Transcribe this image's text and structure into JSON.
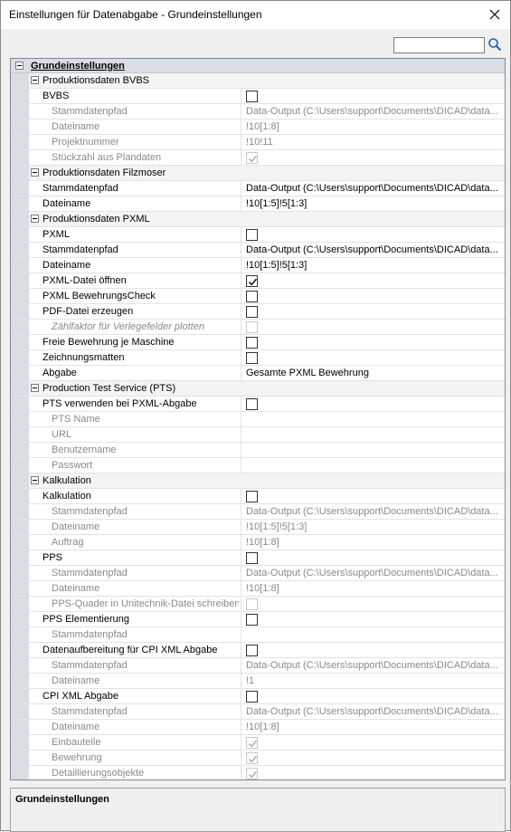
{
  "window": {
    "title": "Einstellungen für Datenabgabe - Grundeinstellungen"
  },
  "search": {
    "value": "",
    "placeholder": ""
  },
  "rows": [
    {
      "type": "top",
      "label": "Grundeinstellungen"
    },
    {
      "type": "cat",
      "label": "Produktionsdaten BVBS"
    },
    {
      "label": "BVBS",
      "checkbox": "unchecked"
    },
    {
      "label": "Stammdatenpfad",
      "sub": true,
      "disabled": true,
      "value": "Data-Output   (C:\\Users\\support\\Documents\\DICAD\\data..."
    },
    {
      "label": "Dateiname",
      "sub": true,
      "disabled": true,
      "value": "!10[1:8]"
    },
    {
      "label": "Projektnummer",
      "sub": true,
      "disabled": true,
      "value": "!10!11"
    },
    {
      "label": "Stückzahl aus Plandaten",
      "sub": true,
      "disabled": true,
      "checkbox": "checked"
    },
    {
      "type": "cat",
      "label": "Produktionsdaten Filzmoser"
    },
    {
      "label": "Stammdatenpfad",
      "value": "Data-Output   (C:\\Users\\support\\Documents\\DICAD\\data..."
    },
    {
      "label": "Dateiname",
      "value": "!10[1:5]!5[1:3]"
    },
    {
      "type": "cat",
      "label": "Produktionsdaten PXML"
    },
    {
      "label": "PXML",
      "checkbox": "unchecked"
    },
    {
      "label": "Stammdatenpfad",
      "value": "Data-Output   (C:\\Users\\support\\Documents\\DICAD\\data..."
    },
    {
      "label": "Dateiname",
      "value": "!10[1:5]!5[1:3]"
    },
    {
      "label": "PXML-Datei öffnen",
      "checkbox": "checked"
    },
    {
      "label": "PXML BewehrungsCheck",
      "checkbox": "unchecked"
    },
    {
      "label": "PDF-Datei erzeugen",
      "checkbox": "unchecked"
    },
    {
      "label": "Zählfaktor für Verlegefelder plotten",
      "sub": true,
      "disabled": true,
      "italic": true,
      "checkbox": "unchecked"
    },
    {
      "label": "Freie Bewehrung je Maschine",
      "checkbox": "unchecked"
    },
    {
      "label": "Zeichnungsmatten",
      "checkbox": "unchecked"
    },
    {
      "label": "Abgabe",
      "value": "Gesamte PXML Bewehrung"
    },
    {
      "type": "cat",
      "label": "Production Test Service (PTS)"
    },
    {
      "label": "PTS verwenden bei PXML-Abgabe",
      "checkbox": "unchecked"
    },
    {
      "label": "PTS Name",
      "sub": true,
      "disabled": true,
      "value": ""
    },
    {
      "label": "URL",
      "sub": true,
      "disabled": true,
      "value": ""
    },
    {
      "label": "Benutzername",
      "sub": true,
      "disabled": true,
      "value": ""
    },
    {
      "label": "Passwort",
      "sub": true,
      "disabled": true,
      "value": ""
    },
    {
      "type": "cat",
      "label": "Kalkulation"
    },
    {
      "label": "Kalkulation",
      "checkbox": "unchecked"
    },
    {
      "label": "Stammdatenpfad",
      "sub": true,
      "disabled": true,
      "value": "Data-Output   (C:\\Users\\support\\Documents\\DICAD\\data..."
    },
    {
      "label": "Dateiname",
      "sub": true,
      "disabled": true,
      "value": "!10[1:5]!5[1:3]"
    },
    {
      "label": "Auftrag",
      "sub": true,
      "disabled": true,
      "value": "!10[1:8]"
    },
    {
      "label": "PPS",
      "checkbox": "unchecked"
    },
    {
      "label": "Stammdatenpfad",
      "sub": true,
      "disabled": true,
      "value": "Data-Output   (C:\\Users\\support\\Documents\\DICAD\\data..."
    },
    {
      "label": "Dateiname",
      "sub": true,
      "disabled": true,
      "value": "!10[1:8]"
    },
    {
      "label": "PPS-Quader in Unitechnik-Datei schreiben",
      "sub": true,
      "disabled": true,
      "checkbox": "unchecked"
    },
    {
      "label": "PPS Elementierung",
      "checkbox": "unchecked"
    },
    {
      "label": "Stammdatenpfad",
      "sub": true,
      "disabled": true,
      "value": ""
    },
    {
      "label": "Datenaufbereitung für CPI XML Abgabe",
      "checkbox": "unchecked"
    },
    {
      "label": "Stammdatenpfad",
      "sub": true,
      "disabled": true,
      "value": "Data-Output   (C:\\Users\\support\\Documents\\DICAD\\data..."
    },
    {
      "label": "Dateiname",
      "sub": true,
      "disabled": true,
      "value": "!1"
    },
    {
      "label": "CPI XML Abgabe",
      "checkbox": "unchecked"
    },
    {
      "label": "Stammdatenpfad",
      "sub": true,
      "disabled": true,
      "value": "Data-Output   (C:\\Users\\support\\Documents\\DICAD\\data..."
    },
    {
      "label": "Dateiname",
      "sub": true,
      "disabled": true,
      "value": "!10[1:8]"
    },
    {
      "label": "Einbauteile",
      "sub": true,
      "disabled": true,
      "checkbox": "checked"
    },
    {
      "label": "Bewehrung",
      "sub": true,
      "disabled": true,
      "checkbox": "checked"
    },
    {
      "label": "Detaillierungsobjekte",
      "sub": true,
      "disabled": true,
      "checkbox": "checked"
    }
  ],
  "description": {
    "title": "Grundeinstellungen"
  }
}
